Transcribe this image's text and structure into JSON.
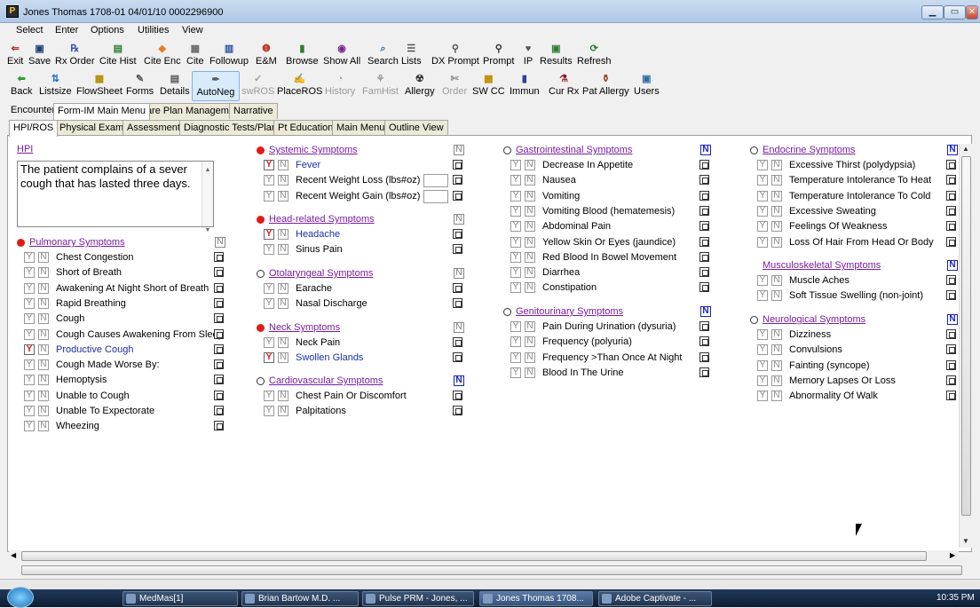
{
  "window": {
    "title": "Jones Thomas 1708-01 04/01/10 0002296900",
    "minimize": "▁",
    "maximize": "▭",
    "close": "✕"
  },
  "menu": [
    "Select",
    "Enter",
    "Options",
    "Utilities",
    "View"
  ],
  "toolbar1": [
    {
      "label": "Exit",
      "icon": "exit-icon",
      "glyph": "⇐",
      "color": "#b3261e"
    },
    {
      "label": "Save",
      "icon": "save-icon",
      "glyph": "▣",
      "color": "#203f7a"
    },
    {
      "label": "Rx Order",
      "icon": "rx-icon",
      "glyph": "℞",
      "color": "#2d52a8"
    },
    {
      "label": "Cite Hist",
      "icon": "cite-hist-icon",
      "glyph": "▤",
      "color": "#2e7d32"
    },
    {
      "label": "Cite Enc",
      "icon": "cite-enc-icon",
      "glyph": "◆",
      "color": "#e67e22"
    },
    {
      "label": "Cite",
      "icon": "cite-icon",
      "glyph": "▦",
      "color": "#6a6a6a"
    },
    {
      "label": "Followup",
      "icon": "followup-icon",
      "glyph": "▥",
      "color": "#2850a0"
    },
    {
      "label": "E&M",
      "icon": "em-icon",
      "glyph": "❶",
      "color": "#c0392b"
    },
    {
      "label": "Browse",
      "icon": "browse-icon",
      "glyph": "▮",
      "color": "#2e7d32"
    },
    {
      "label": "Show All",
      "icon": "show-all-icon",
      "glyph": "◉",
      "color": "#7b2c8e"
    },
    {
      "label": "Search",
      "icon": "search-icon",
      "glyph": "⌕",
      "color": "#2e6da4"
    },
    {
      "label": "Lists",
      "icon": "lists-icon",
      "glyph": "☰",
      "color": "#555555"
    },
    {
      "label": "DX Prompt",
      "icon": "dx-prompt-icon",
      "glyph": "⚲",
      "color": "#555555"
    },
    {
      "label": "Prompt",
      "icon": "prompt-icon",
      "glyph": "⚲",
      "color": "#333333"
    },
    {
      "label": "IP",
      "icon": "ip-icon",
      "glyph": "♥",
      "color": "#555555"
    },
    {
      "label": "Results",
      "icon": "results-icon",
      "glyph": "▣",
      "color": "#2e7d32"
    },
    {
      "label": "Refresh",
      "icon": "refresh-icon",
      "glyph": "⟳",
      "color": "#2e7d32"
    }
  ],
  "toolbar2": [
    {
      "label": "Back",
      "icon": "back-arrow-icon",
      "glyph": "⬅",
      "color": "#2e9c31",
      "disabled": false
    },
    {
      "label": "Listsize",
      "icon": "listsize-icon",
      "glyph": "⇅",
      "color": "#1f6fd6",
      "disabled": false
    },
    {
      "label": "FlowSheet",
      "icon": "flowsheet-icon",
      "glyph": "▦",
      "color": "#b58b00",
      "disabled": false
    },
    {
      "label": "Forms",
      "icon": "forms-icon",
      "glyph": "✎",
      "color": "#555555",
      "disabled": false
    },
    {
      "label": "Details",
      "icon": "details-icon",
      "glyph": "▤",
      "color": "#555555",
      "disabled": false
    },
    {
      "label": "AutoNeg",
      "icon": "autoneg-icon",
      "glyph": "✒",
      "color": "#555555",
      "disabled": false
    },
    {
      "label": "swROS",
      "icon": "swros-icon",
      "glyph": "✓",
      "color": "#999999",
      "disabled": true
    },
    {
      "label": "PlaceROS",
      "icon": "placeros-icon",
      "glyph": "✍",
      "color": "#555555",
      "disabled": false
    },
    {
      "label": "History",
      "icon": "history-icon",
      "glyph": "◔",
      "color": "#999999",
      "disabled": true
    },
    {
      "label": "FamHist",
      "icon": "famhist-icon",
      "glyph": "⚘",
      "color": "#999999",
      "disabled": true
    },
    {
      "label": "Allergy",
      "icon": "allergy-icon",
      "glyph": "☢",
      "color": "#333333",
      "disabled": false
    },
    {
      "label": "Order",
      "icon": "order-icon",
      "glyph": "✄",
      "color": "#999999",
      "disabled": true
    },
    {
      "label": "SW CC",
      "icon": "sw-cc-icon",
      "glyph": "▩",
      "color": "#c48a00",
      "disabled": false
    },
    {
      "label": "Immun",
      "icon": "immun-icon",
      "glyph": "▮",
      "color": "#2d3fa0",
      "disabled": false
    },
    {
      "label": "Cur Rx",
      "icon": "cur-rx-icon",
      "glyph": "⚗",
      "color": "#8e1c1c",
      "disabled": false
    },
    {
      "label": "Pat Allergy",
      "icon": "pat-allergy-icon",
      "glyph": "⚱",
      "color": "#8e3b1c",
      "disabled": false
    },
    {
      "label": "Users",
      "icon": "users-icon",
      "glyph": "▣",
      "color": "#2e6da4",
      "disabled": false
    }
  ],
  "tabs_top": [
    "Encounter",
    "Form-IM Main Menu",
    "Care Plan Management",
    "Narrative"
  ],
  "tabs_sub": [
    "HPI/ROS",
    "Physical Exam",
    "Assessment",
    "Diagnostic Tests/Plan",
    "Pt Education",
    "Main Menu",
    "Outline View"
  ],
  "hpi": {
    "label": "HPI",
    "text": "The patient complains of a sever cough that has lasted three days."
  },
  "yes_mark": "Y",
  "no_mark": "N",
  "sections": [
    {
      "id": "pulmonary",
      "title": "Pulmonary Symptoms",
      "dot": "red",
      "n_blue": false,
      "items": [
        {
          "label": "Chest Congestion",
          "yes": false
        },
        {
          "label": "Short of Breath",
          "yes": false
        },
        {
          "label": " Awakening At Night Short of Breath",
          "yes": false
        },
        {
          "label": "Rapid Breathing",
          "yes": false
        },
        {
          "label": "Cough",
          "yes": false
        },
        {
          "label": "Cough Causes Awakening From Sleep",
          "yes": false
        },
        {
          "label": "Productive Cough",
          "yes": true
        },
        {
          "label": "Cough Made Worse By:",
          "yes": false
        },
        {
          "label": "Hemoptysis",
          "yes": false
        },
        {
          "label": "Unable to Cough",
          "yes": false
        },
        {
          "label": "Unable To Expectorate",
          "yes": false
        },
        {
          "label": "Wheezing",
          "yes": false
        }
      ]
    },
    {
      "id": "systemic",
      "title": "Systemic Symptoms",
      "dot": "red",
      "n_blue": false,
      "items": [
        {
          "label": "Fever",
          "yes": true
        },
        {
          "label": "Recent Weight Loss  (lbs#oz)",
          "yes": false,
          "field": true
        },
        {
          "label": "Recent Weight Gain (lbs#oz)",
          "yes": false,
          "field": true
        }
      ]
    },
    {
      "id": "head",
      "title": "Head-related Symptoms",
      "dot": "red",
      "n_blue": false,
      "items": [
        {
          "label": "Headache",
          "yes": true
        },
        {
          "label": "Sinus Pain",
          "yes": false
        }
      ]
    },
    {
      "id": "otolaryngeal",
      "title": "Otolaryngeal Symptoms",
      "dot": "hollow",
      "n_blue": false,
      "items": [
        {
          "label": "Earache",
          "yes": false
        },
        {
          "label": "Nasal Discharge",
          "yes": false
        }
      ]
    },
    {
      "id": "neck",
      "title": "Neck Symptoms",
      "dot": "red",
      "n_blue": false,
      "items": [
        {
          "label": "Neck Pain",
          "yes": false
        },
        {
          "label": "Swollen Glands",
          "yes": true
        }
      ]
    },
    {
      "id": "cardio",
      "title": "Cardiovascular Symptoms",
      "dot": "hollow",
      "n_blue": true,
      "items": [
        {
          "label": "Chest Pain Or Discomfort",
          "yes": false
        },
        {
          "label": "Palpitations",
          "yes": false
        }
      ]
    },
    {
      "id": "gi",
      "title": "Gastrointestinal Symptoms",
      "dot": "hollow",
      "n_blue": true,
      "items": [
        {
          "label": "Decrease In Appetite",
          "yes": false
        },
        {
          "label": "Nausea",
          "yes": false
        },
        {
          "label": "Vomiting",
          "yes": false
        },
        {
          "label": "Vomiting Blood (hematemesis)",
          "yes": false
        },
        {
          "label": "Abdominal Pain",
          "yes": false
        },
        {
          "label": "Yellow Skin Or Eyes (jaundice)",
          "yes": false
        },
        {
          "label": "Red Blood In Bowel Movement",
          "yes": false
        },
        {
          "label": "Diarrhea",
          "yes": false
        },
        {
          "label": "Constipation",
          "yes": false
        }
      ]
    },
    {
      "id": "gu",
      "title": "Genitourinary Symptoms",
      "dot": "hollow",
      "n_blue": true,
      "items": [
        {
          "label": "Pain During Urination (dysuria)",
          "yes": false
        },
        {
          "label": "Frequency (polyuria)",
          "yes": false
        },
        {
          "label": "Frequency >Than Once At Night",
          "yes": false
        },
        {
          "label": "Blood In The Urine",
          "yes": false
        }
      ]
    },
    {
      "id": "endocrine",
      "title": "Endocrine Symptoms",
      "dot": "hollow",
      "n_blue": true,
      "items": [
        {
          "label": "Excessive Thirst (polydypsia)",
          "yes": false
        },
        {
          "label": "Temperature Intolerance To Heat",
          "yes": false
        },
        {
          "label": "Temperature Intolerance To Cold",
          "yes": false
        },
        {
          "label": "Excessive Sweating",
          "yes": false
        },
        {
          "label": "Feelings Of Weakness",
          "yes": false
        },
        {
          "label": "Loss Of Hair From Head Or Body",
          "yes": false
        }
      ]
    },
    {
      "id": "msk",
      "title": "Musculoskeletal Symptoms",
      "dot": "none",
      "n_blue": true,
      "items": [
        {
          "label": "Muscle Aches",
          "yes": false
        },
        {
          "label": "Soft Tissue Swelling (non-joint)",
          "yes": false
        }
      ]
    },
    {
      "id": "neuro",
      "title": "Neurological Symptoms",
      "dot": "hollow",
      "n_blue": true,
      "items": [
        {
          "label": "Dizziness",
          "yes": false
        },
        {
          "label": "Convulsions",
          "yes": false
        },
        {
          "label": "Fainting (syncope)",
          "yes": false
        },
        {
          "label": "Memory Lapses Or Loss",
          "yes": false
        },
        {
          "label": "Abnormality Of Walk",
          "yes": false
        }
      ]
    }
  ],
  "taskbar": {
    "items": [
      "MedMas[1]",
      "Brian Bartow M.D. ...",
      "Pulse PRM - Jones, ...",
      "Jones Thomas 1708...",
      "Adobe Captivate - ..."
    ],
    "clock": "10:35 PM"
  },
  "colors": {
    "yes_red": "#d21b1b",
    "n_blue": "#1822c4",
    "header_purple": "#7a1ca0",
    "highlight_blue": "#1a2fa8"
  }
}
